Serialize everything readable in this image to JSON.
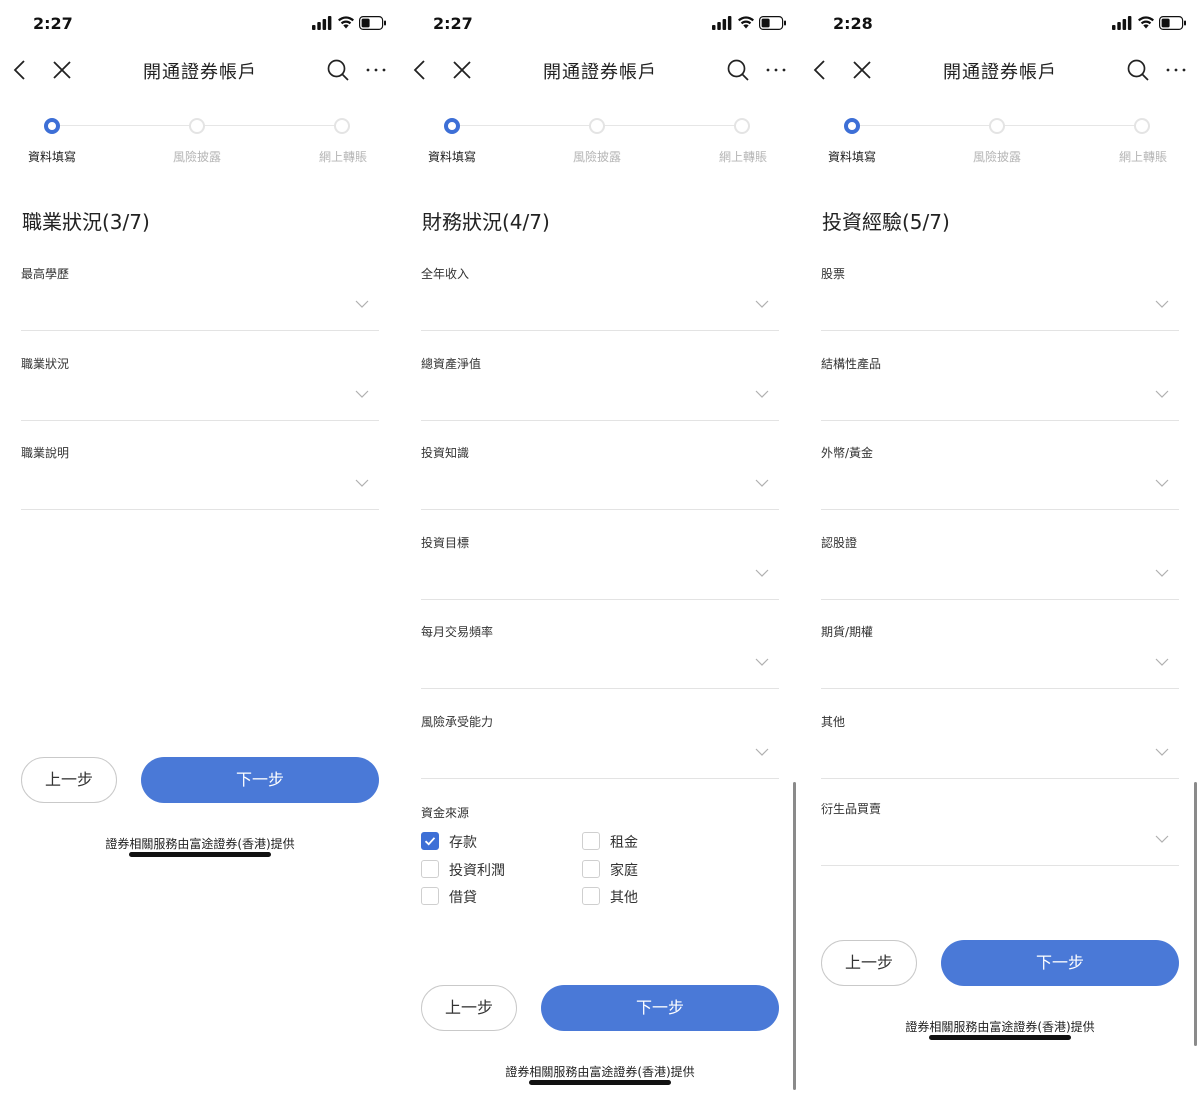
{
  "screens": [
    {
      "time": "2:27",
      "title": "開通證券帳戶",
      "steps": [
        "資料填寫",
        "風險披露",
        "網上轉賬"
      ],
      "section_title": "職業狀況(3/7)",
      "fields": [
        "最高學歷",
        "職業狀況",
        "職業說明"
      ],
      "prev_label": "上一步",
      "next_label": "下一步",
      "footer": "證券相關服務由富途證券(香港)提供"
    },
    {
      "time": "2:27",
      "title": "開通證券帳戶",
      "steps": [
        "資料填寫",
        "風險披露",
        "網上轉賬"
      ],
      "section_title": "財務狀況(4/7)",
      "fields": [
        "全年收入",
        "總資產淨值",
        "投資知識",
        "投資目標",
        "每月交易頻率",
        "風險承受能力"
      ],
      "funds_label": "資金來源",
      "funds_options": [
        {
          "label": "存款",
          "checked": true
        },
        {
          "label": "租金",
          "checked": false
        },
        {
          "label": "投資利潤",
          "checked": false
        },
        {
          "label": "家庭",
          "checked": false
        },
        {
          "label": "借貸",
          "checked": false
        },
        {
          "label": "其他",
          "checked": false
        }
      ],
      "prev_label": "上一步",
      "next_label": "下一步",
      "footer": "證券相關服務由富途證券(香港)提供"
    },
    {
      "time": "2:28",
      "title": "開通證券帳戶",
      "steps": [
        "資料填寫",
        "風險披露",
        "網上轉賬"
      ],
      "section_title": "投資經驗(5/7)",
      "fields": [
        "股票",
        "結構性產品",
        "外幣/黃金",
        "認股證",
        "期貨/期權",
        "其他",
        "衍生品買賣"
      ],
      "prev_label": "上一步",
      "next_label": "下一步",
      "footer": "證券相關服務由富途證券(香港)提供"
    }
  ],
  "colors": {
    "accent": "#3d6fd6",
    "button_primary": "#4a79d7",
    "divider": "#e3e3e3",
    "inactive_step": "#b5b5b5"
  }
}
